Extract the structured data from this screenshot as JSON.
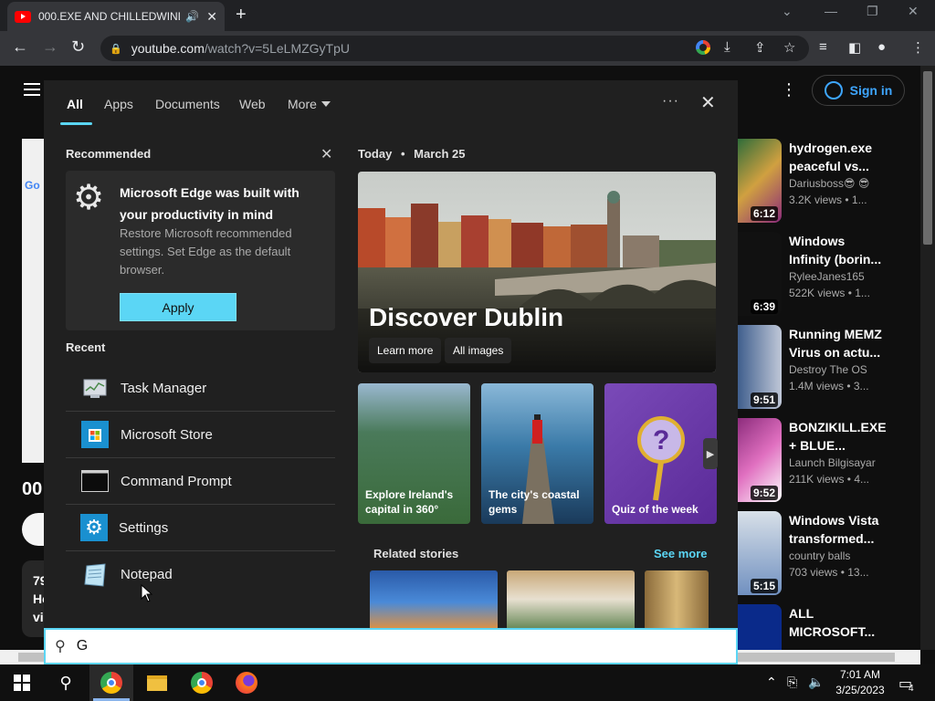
{
  "browser": {
    "tab_title": "000.EXE AND CHILLEDWIND",
    "url_host": "youtube.com",
    "url_path": "/watch?v=5LeLMZGyTpU"
  },
  "youtube": {
    "signin_label": "Sign in",
    "left_partial_title": "00",
    "left_partial_lines": [
      "79",
      "He",
      "vi"
    ],
    "videos": [
      {
        "title": "hydrogen.exe peaceful vs...",
        "channel": "Dariusboss😎 😎",
        "meta": "3.2K views • 1...",
        "duration": "6:12",
        "color": "#2a6b3a"
      },
      {
        "title": "Windows Infinity (borin...",
        "channel": "RyleeJanes165",
        "meta": "522K views • 1...",
        "duration": "6:39",
        "color": "#111111"
      },
      {
        "title": "Running MEMZ Virus on actu...",
        "channel": "Destroy The OS",
        "meta": "1.4M views • 3...",
        "duration": "9:51",
        "color": "#3a5a8a"
      },
      {
        "title": "BONZIKILL.EXE + BLUE...",
        "channel": "Launch Bilgisayar",
        "meta": "211K views • 4...",
        "duration": "9:52",
        "color": "#8a2a7a"
      },
      {
        "title": "Windows Vista transformed...",
        "channel": "country balls",
        "meta": "703 views • 13...",
        "duration": "5:15",
        "color": "#c8d0d8"
      },
      {
        "title": "ALL MICROSOFT...",
        "channel": "",
        "meta": "",
        "duration": "",
        "color": "#0a2a8a"
      }
    ]
  },
  "search": {
    "tabs": [
      "All",
      "Apps",
      "Documents",
      "Web",
      "More"
    ],
    "recommended_title": "Recommended",
    "rec_heading": "Microsoft Edge was built with your productivity in mind",
    "rec_body": "Restore Microsoft recommended settings. Set Edge as the default browser.",
    "apply_label": "Apply",
    "recent_title": "Recent",
    "recent_items": [
      "Task Manager",
      "Microsoft Store",
      "Command Prompt",
      "Settings",
      "Notepad"
    ],
    "date_today": "Today",
    "date_value": "March 25",
    "hero_title": "Discover Dublin",
    "hero_learn": "Learn more",
    "hero_images": "All images",
    "cards": [
      "Explore Ireland's capital in 360°",
      "The city's coastal gems",
      "Quiz of the week"
    ],
    "related_title": "Related stories",
    "see_more": "See more",
    "query": "G",
    "accent": "#5bd6f5"
  },
  "taskbar": {
    "time": "7:01 AM",
    "date": "3/25/2023",
    "notification_count": "4"
  }
}
